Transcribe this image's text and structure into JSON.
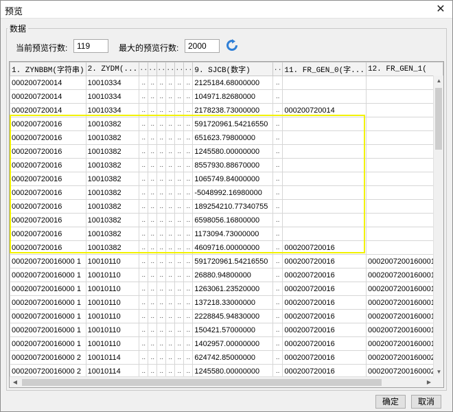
{
  "window": {
    "title": "预览",
    "close_glyph": "✕"
  },
  "group": {
    "title": "数据"
  },
  "settings": {
    "current_rows_label": "当前预览行数:",
    "current_rows_value": "119",
    "max_rows_label": "最大的预览行数:",
    "max_rows_value": "2000",
    "refresh_icon": "refresh-icon"
  },
  "table": {
    "headers": [
      "1. ZYNBBM(字符串)",
      "2. ZYDM(...",
      "..",
      "..",
      "..",
      "..",
      "..",
      "..",
      "9. SJCB(数字)",
      "..",
      "11. FR_GEN_0(字...",
      "12. FR_GEN_1("
    ],
    "rows": [
      [
        "000200720014",
        "10010334",
        "..",
        "..",
        "..",
        "..",
        "..",
        "..",
        "2125184.68000000",
        "..",
        "",
        ""
      ],
      [
        "000200720014",
        "10010334",
        "..",
        "..",
        "..",
        "..",
        "..",
        "..",
        "104971.82680000",
        "..",
        "",
        ""
      ],
      [
        "000200720014",
        "10010334",
        "..",
        "..",
        "..",
        "..",
        "..",
        "..",
        "2178238.73000000",
        "..",
        "000200720014",
        ""
      ],
      [
        "000200720016",
        "10010382",
        "..",
        "..",
        "..",
        "..",
        "..",
        "..",
        "591720961.54216550",
        "..",
        "",
        ""
      ],
      [
        "000200720016",
        "10010382",
        "..",
        "..",
        "..",
        "..",
        "..",
        "..",
        "651623.79800000",
        "..",
        "",
        ""
      ],
      [
        "000200720016",
        "10010382",
        "..",
        "..",
        "..",
        "..",
        "..",
        "..",
        "1245580.00000000",
        "..",
        "",
        ""
      ],
      [
        "000200720016",
        "10010382",
        "..",
        "..",
        "..",
        "..",
        "..",
        "..",
        "8557930.88670000",
        "..",
        "",
        ""
      ],
      [
        "000200720016",
        "10010382",
        "..",
        "..",
        "..",
        "..",
        "..",
        "..",
        "1065749.84000000",
        "..",
        "",
        ""
      ],
      [
        "000200720016",
        "10010382",
        "..",
        "..",
        "..",
        "..",
        "..",
        "..",
        "-5048992.16980000",
        "..",
        "",
        ""
      ],
      [
        "000200720016",
        "10010382",
        "..",
        "..",
        "..",
        "..",
        "..",
        "..",
        "189254210.77340755",
        "..",
        "",
        ""
      ],
      [
        "000200720016",
        "10010382",
        "..",
        "..",
        "..",
        "..",
        "..",
        "..",
        "6598056.16800000",
        "..",
        "",
        ""
      ],
      [
        "000200720016",
        "10010382",
        "..",
        "..",
        "..",
        "..",
        "..",
        "..",
        "1173094.73000000",
        "..",
        "",
        ""
      ],
      [
        "000200720016",
        "10010382",
        "..",
        "..",
        "..",
        "..",
        "..",
        "..",
        "4609716.00000000",
        "..",
        "000200720016",
        ""
      ],
      [
        "000200720016000 1",
        "10010110",
        "..",
        "..",
        "..",
        "..",
        "..",
        "..",
        "591720961.54216550",
        "..",
        "000200720016",
        "0002007200160001"
      ],
      [
        "000200720016000 1",
        "10010110",
        "..",
        "..",
        "..",
        "..",
        "..",
        "..",
        "26880.94800000",
        "..",
        "000200720016",
        "0002007200160001"
      ],
      [
        "000200720016000 1",
        "10010110",
        "..",
        "..",
        "..",
        "..",
        "..",
        "..",
        "1263061.23520000",
        "..",
        "000200720016",
        "0002007200160001"
      ],
      [
        "000200720016000 1",
        "10010110",
        "..",
        "..",
        "..",
        "..",
        "..",
        "..",
        "137218.33000000",
        "..",
        "000200720016",
        "0002007200160001"
      ],
      [
        "000200720016000 1",
        "10010110",
        "..",
        "..",
        "..",
        "..",
        "..",
        "..",
        "2228845.94830000",
        "..",
        "000200720016",
        "0002007200160001"
      ],
      [
        "000200720016000 1",
        "10010110",
        "..",
        "..",
        "..",
        "..",
        "..",
        "..",
        "150421.57000000",
        "..",
        "000200720016",
        "0002007200160001"
      ],
      [
        "000200720016000 1",
        "10010110",
        "..",
        "..",
        "..",
        "..",
        "..",
        "..",
        "1402957.00000000",
        "..",
        "000200720016",
        "0002007200160001"
      ],
      [
        "000200720016000 2",
        "10010114",
        "..",
        "..",
        "..",
        "..",
        "..",
        "..",
        "624742.85000000",
        "..",
        "000200720016",
        "0002007200160002"
      ],
      [
        "000200720016000 2",
        "10010114",
        "..",
        "..",
        "..",
        "..",
        "..",
        "..",
        "1245580.00000000",
        "..",
        "000200720016",
        "0002007200160002"
      ]
    ]
  },
  "buttons": {
    "ok": "确定",
    "cancel": "取消"
  },
  "colors": {
    "highlight": "#f2f200",
    "refresh": "#2f7fd6"
  }
}
